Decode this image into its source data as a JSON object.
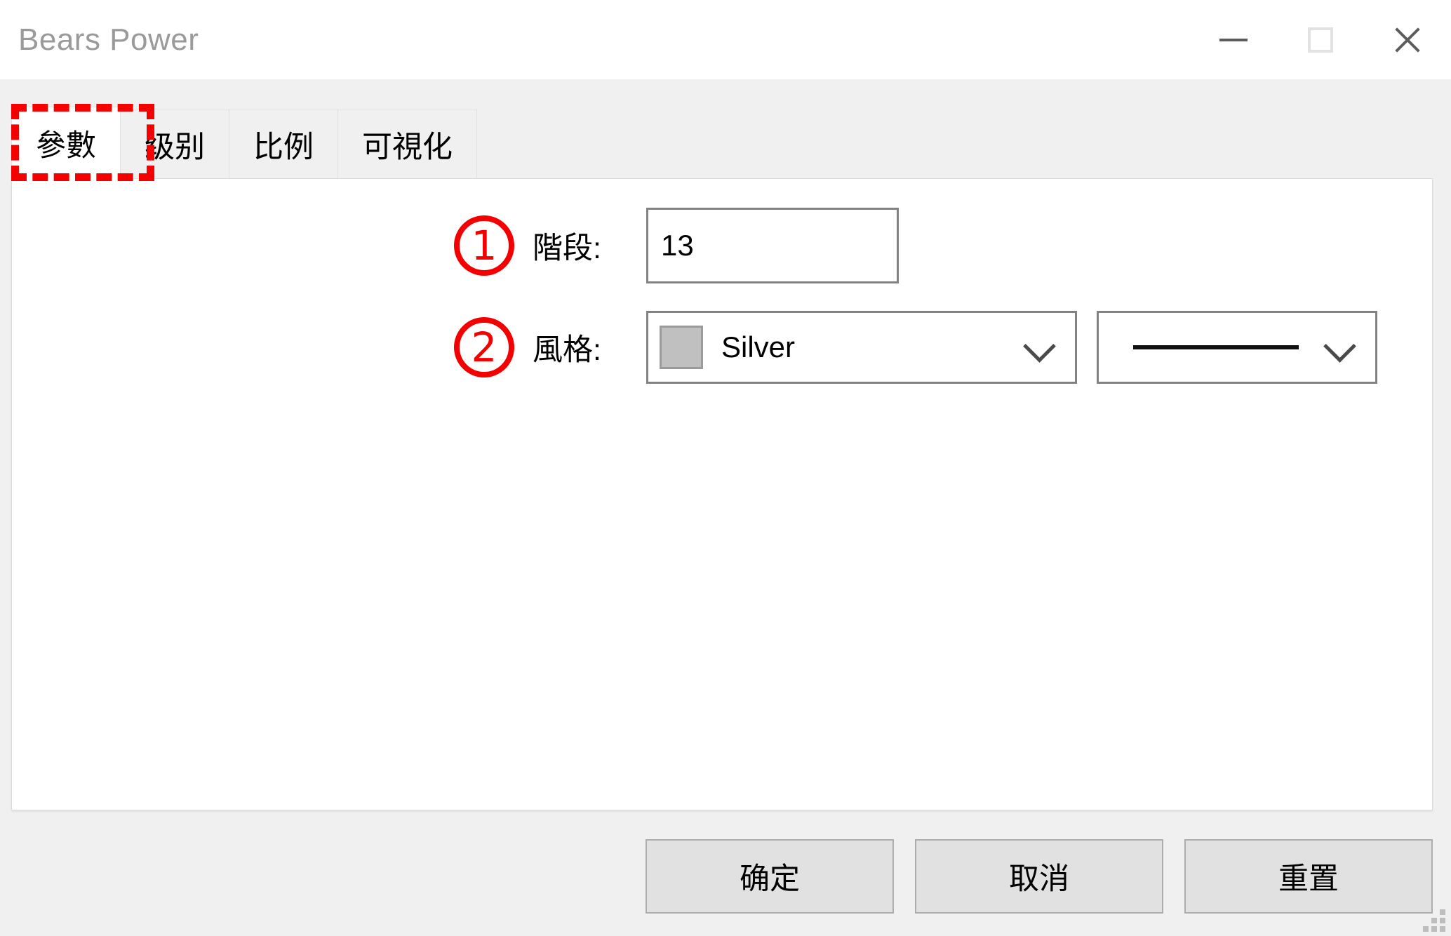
{
  "window": {
    "title": "Bears Power",
    "controls": [
      {
        "name": "minimize",
        "icon": "minimize-icon",
        "label": "—"
      },
      {
        "name": "maximize",
        "icon": "maximize-icon",
        "label": "□"
      },
      {
        "name": "close",
        "icon": "close-icon",
        "label": "✕"
      }
    ],
    "resize_grip_icon": "resize-grip-icon"
  },
  "tabs": [
    {
      "label": "參數",
      "active": true
    },
    {
      "label": "级别",
      "active": false
    },
    {
      "label": "比例",
      "active": false
    },
    {
      "label": "可視化",
      "active": false
    }
  ],
  "form": {
    "period": {
      "badge": "1",
      "label": "階段:",
      "value": "13",
      "placeholder": ""
    },
    "style": {
      "badge": "2",
      "label": "風格:",
      "color_name": "Silver",
      "color_hex": "#c0c0c0",
      "line_style": "solid",
      "chevron_icon": "chevron-down-icon"
    }
  },
  "buttons": {
    "ok": "确定",
    "cancel": "取消",
    "reset": "重置"
  },
  "annotation": {
    "highlight_color": "#f40000",
    "highlighted_tab": "參數"
  }
}
